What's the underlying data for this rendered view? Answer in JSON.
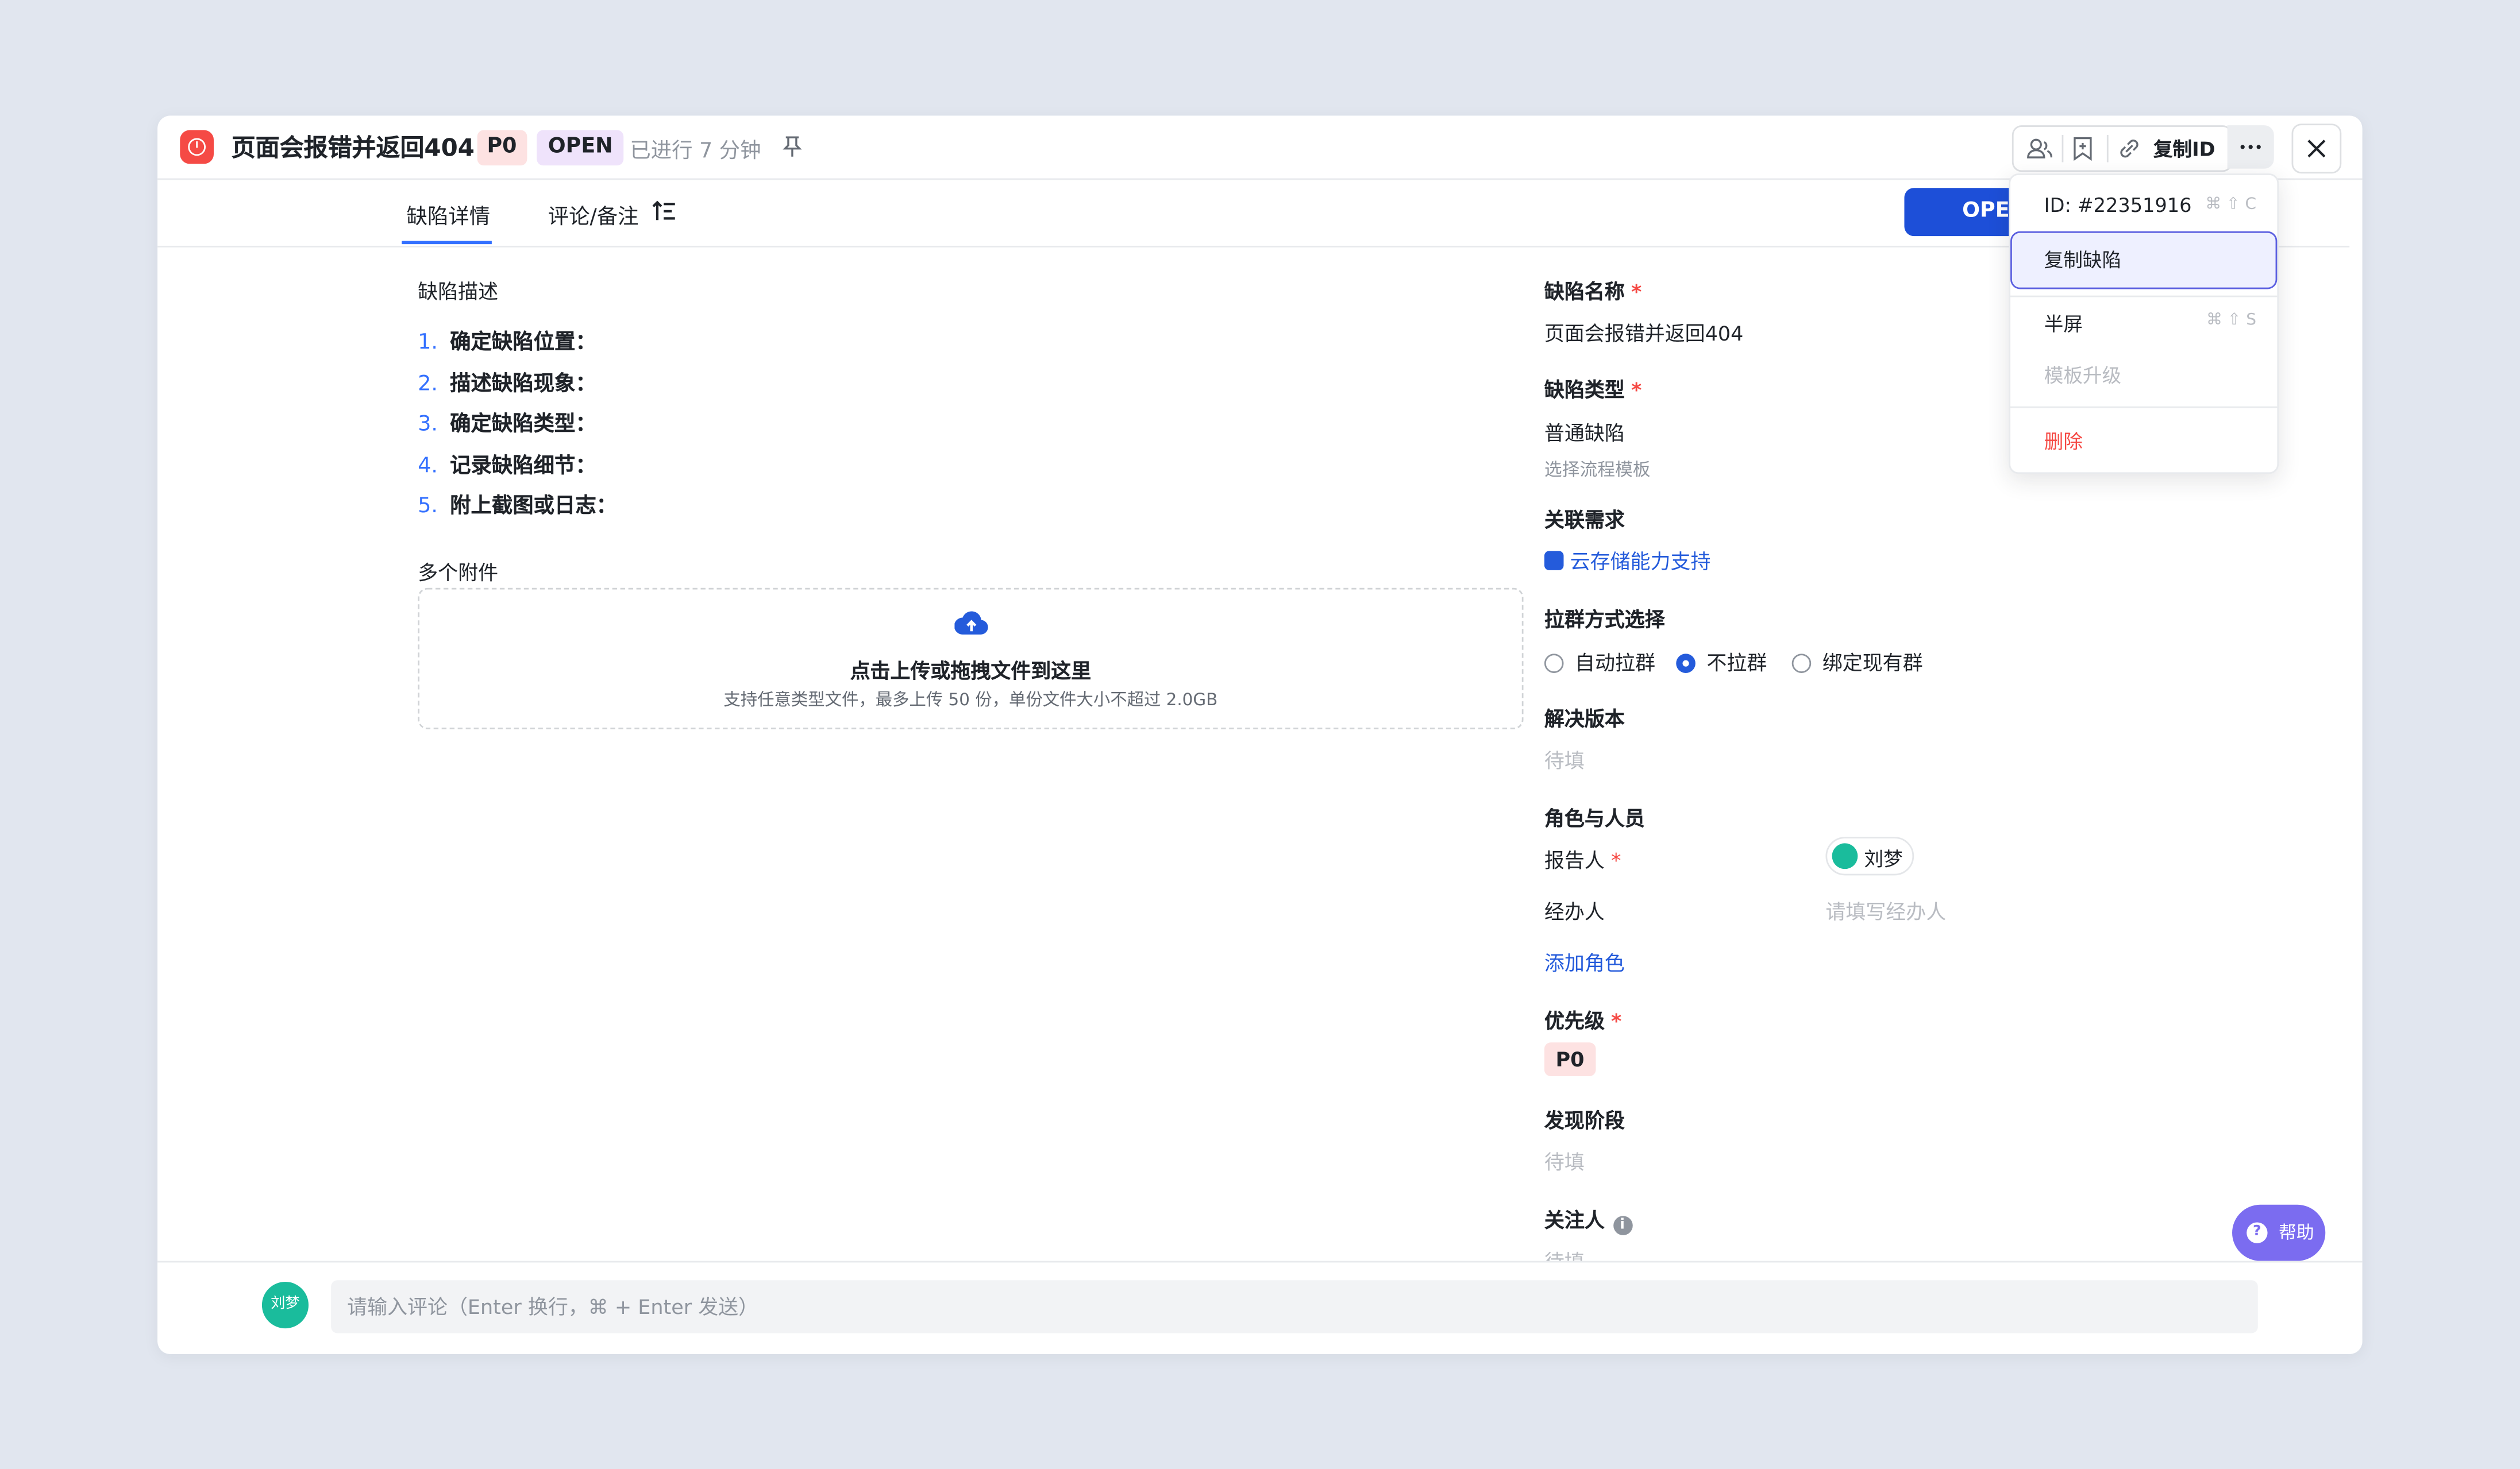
{
  "header": {
    "title": "页面会报错并返回404",
    "priority_tag": "P0",
    "status_tag": "OPEN",
    "elapsed": "已进行 7 分钟",
    "copy_id_label": "复制ID"
  },
  "tabs": [
    {
      "label": "缺陷详情"
    },
    {
      "label": "评论/备注"
    }
  ],
  "status_button": "OPEN",
  "description": {
    "label": "缺陷描述",
    "steps": [
      {
        "num": "1.",
        "text": "确定缺陷位置："
      },
      {
        "num": "2.",
        "text": "描述缺陷现象："
      },
      {
        "num": "3.",
        "text": "确定缺陷类型："
      },
      {
        "num": "4.",
        "text": "记录缺陷细节："
      },
      {
        "num": "5.",
        "text": "附上截图或日志："
      }
    ]
  },
  "attachments": {
    "label": "多个附件",
    "upload_main": "点击上传或拖拽文件到这里",
    "upload_sub": "支持任意类型文件，最多上传 50 份，单份文件大小不超过 2.0GB"
  },
  "fields": {
    "name_label": "缺陷名称",
    "name_value": "页面会报错并返回404",
    "type_label": "缺陷类型",
    "type_value": "普通缺陷",
    "type_hint": "选择流程模板",
    "req_label": "关联需求",
    "req_value": "云存储能力支持",
    "group_label": "拉群方式选择",
    "group_options": [
      "自动拉群",
      "不拉群",
      "绑定现有群"
    ],
    "group_selected": "不拉群",
    "version_label": "解决版本",
    "version_placeholder": "待填",
    "roles_label": "角色与人员",
    "reporter_label": "报告人",
    "reporter_value": "刘梦",
    "handler_label": "经办人",
    "handler_placeholder": "请填写经办人",
    "add_role": "添加角色",
    "priority_label": "优先级",
    "priority_value": "P0",
    "stage_label": "发现阶段",
    "stage_placeholder": "待填",
    "follower_label": "关注人",
    "follower_placeholder": "待填"
  },
  "dropdown": {
    "id_text": "ID: #22351916",
    "id_shortcut": "⌘ ⇧ C",
    "copy_defect": "复制缺陷",
    "half_screen": "半屏",
    "half_shortcut": "⌘ ⇧ S",
    "template_upgrade": "模板升级",
    "delete": "删除"
  },
  "help_label": "帮助",
  "footer": {
    "avatar_text": "刘梦",
    "comment_placeholder": "请输入评论（Enter 换行，⌘ + Enter 发送）"
  },
  "colors": {
    "accent": "#245bdb",
    "danger": "#f54a45",
    "background": "#e1e6ef",
    "help": "#7b6cf0"
  }
}
